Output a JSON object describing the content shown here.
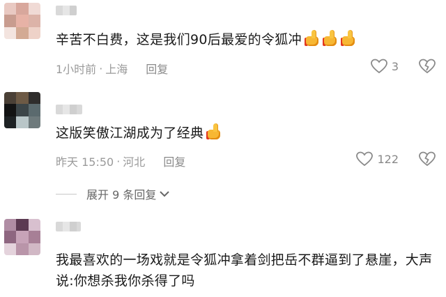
{
  "comments": [
    {
      "text": "辛苦不白费，这是我们90后最爱的令狐冲",
      "time": "1小时前",
      "location": "上海",
      "reply_label": "回复",
      "likes": "3",
      "reaction_icons": [
        "thumbs-up-icon",
        "thumbs-up-icon",
        "thumbs-up-icon"
      ]
    },
    {
      "text": "这版笑傲江湖成为了经典",
      "time": "昨天 15:50",
      "location": "河北",
      "reply_label": "回复",
      "likes": "122",
      "reaction_icons": [
        "thumbs-up-icon"
      ]
    },
    {
      "text": "我最喜欢的一场戏就是令狐冲拿着剑把岳不群逼到了悬崖，大声说:你想杀我你杀得了吗"
    }
  ],
  "expand_replies_label": "展开 9 条回复",
  "colors": {
    "text": "#1a1a1a",
    "meta": "#9a9a9a",
    "thumb": "#f7b733",
    "thumb_cuff": "#e2371f"
  }
}
